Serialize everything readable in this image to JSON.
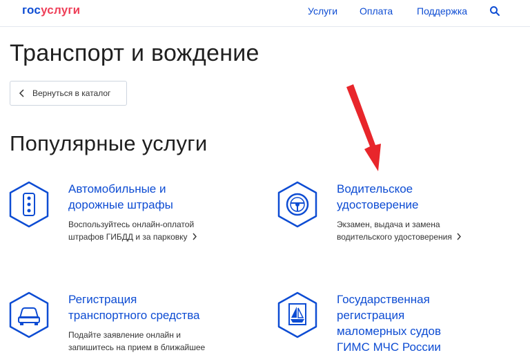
{
  "header": {
    "logo_part1": "гос",
    "logo_part2": "услуги",
    "nav": [
      "Услуги",
      "Оплата",
      "Поддержка"
    ]
  },
  "page": {
    "title": "Транспорт и вождение",
    "back_label": "Вернуться в каталог",
    "section_title": "Популярные услуги"
  },
  "cards": [
    {
      "title_lines": [
        "Автомобильные и",
        "дорожные штрафы"
      ],
      "desc_lines": [
        "Воспользуйтесь онлайн-оплатой",
        "штрафов ГИБДД и за парковку"
      ],
      "icon": "traffic-light-icon"
    },
    {
      "title_lines": [
        "Водительское",
        "удостоверение"
      ],
      "desc_lines": [
        "Экзамен, выдача и замена",
        "водительского удостоверения"
      ],
      "icon": "steering-wheel-icon"
    },
    {
      "title_lines": [
        "Регистрация",
        "транспортного средства"
      ],
      "desc_lines": [
        "Подайте заявление онлайн и",
        "запишитесь на прием в ближайшее"
      ],
      "icon": "car-icon"
    },
    {
      "title_lines": [
        "Государственная",
        "регистрация",
        "маломерных судов",
        "ГИМС МЧС России"
      ],
      "desc_lines": [],
      "icon": "boat-icon"
    }
  ],
  "colors": {
    "brand_blue": "#0d4cd3",
    "brand_red": "#ee3f58",
    "annotation_arrow": "#e8262b"
  }
}
